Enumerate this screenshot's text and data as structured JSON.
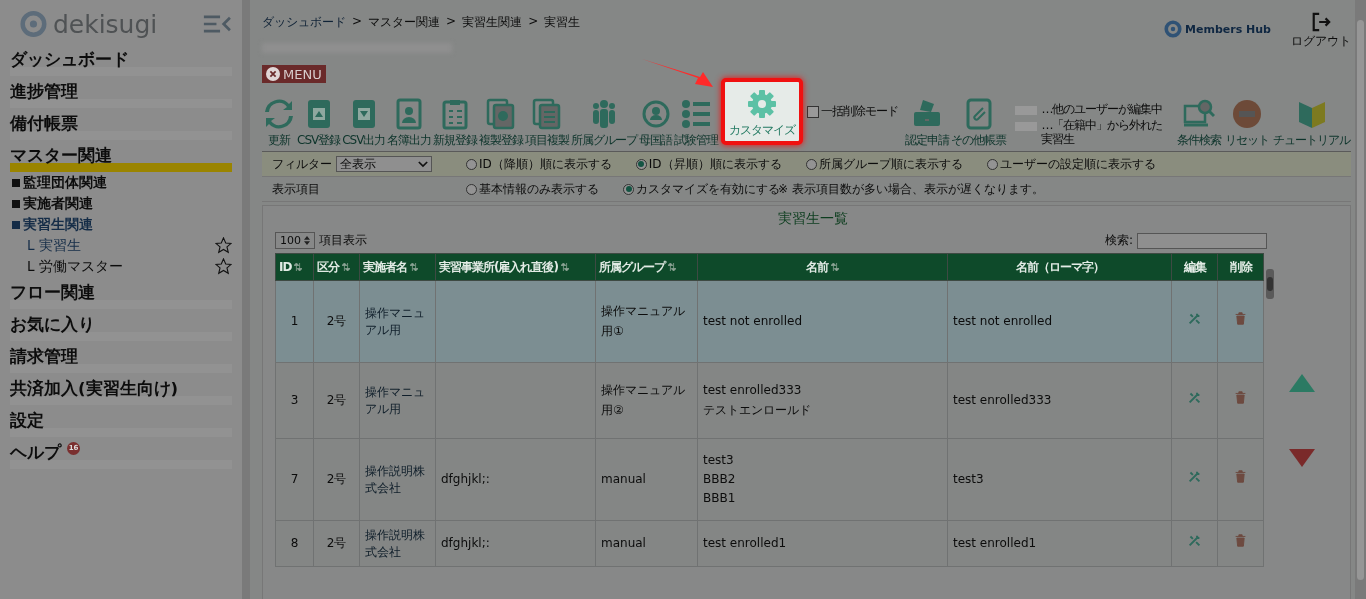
{
  "sidebar": {
    "logo": "dekisugi",
    "items": [
      {
        "label": "ダッシュボード",
        "selected": false
      },
      {
        "label": "進捗管理",
        "selected": false
      },
      {
        "label": "備付帳票",
        "selected": false
      },
      {
        "label": "マスター関連",
        "selected": true,
        "children": [
          {
            "label": "監理団体関連",
            "selected": false
          },
          {
            "label": "実施者関連",
            "selected": false
          },
          {
            "label": "実習生関連",
            "selected": true,
            "children": [
              {
                "label": "L 実習生",
                "selected": true,
                "starred": false
              },
              {
                "label": "L 労働マスター",
                "selected": false,
                "starred": false
              }
            ]
          }
        ]
      },
      {
        "label": "フロー関連",
        "selected": false
      },
      {
        "label": "お気に入り",
        "selected": false
      },
      {
        "label": "請求管理",
        "selected": false
      },
      {
        "label": "共済加入(実習生向け)",
        "selected": false
      },
      {
        "label": "設定",
        "selected": false
      },
      {
        "label": "ヘルプ",
        "selected": false,
        "badge": "16"
      }
    ]
  },
  "breadcrumb": [
    {
      "kind": "link",
      "text": "ダッシュボード"
    },
    {
      "kind": "sep",
      "text": ">"
    },
    {
      "kind": "text",
      "text": "マスター関連"
    },
    {
      "kind": "sep",
      "text": ">"
    },
    {
      "kind": "text",
      "text": "実習生関連"
    },
    {
      "kind": "sep",
      "text": ">"
    },
    {
      "kind": "text",
      "text": "実習生"
    }
  ],
  "header": {
    "brand": "Members Hub",
    "logout": "ログアウト"
  },
  "menu_button": "MENU",
  "tools": [
    {
      "label": "更新",
      "highlighted": false
    },
    {
      "label": "CSV登録",
      "highlighted": false
    },
    {
      "label": "CSV出力",
      "highlighted": false
    },
    {
      "label": "名簿出力",
      "highlighted": false
    },
    {
      "label": "新規登録",
      "highlighted": false
    },
    {
      "label": "複製登録",
      "highlighted": false
    },
    {
      "label": "項目複製",
      "highlighted": false
    },
    {
      "label": "所属グループ",
      "highlighted": false
    },
    {
      "label": "母国語",
      "highlighted": false
    },
    {
      "label": "試験管理",
      "highlighted": false
    },
    {
      "label": "カスタマイズ",
      "highlighted": true
    }
  ],
  "bulk_delete": {
    "label": "一括削除モード",
    "checked": false
  },
  "tools_2": [
    {
      "label": "認定申請"
    },
    {
      "label": "その他帳票"
    }
  ],
  "legend": [
    {
      "text": "…他のユーザーが編集中"
    },
    {
      "text": "…「在籍中」から外れた実習生"
    }
  ],
  "tools_3": [
    {
      "label": "条件検索"
    },
    {
      "label": "リセット"
    },
    {
      "label": "チュートリアル"
    }
  ],
  "filter": {
    "label": "フィルター",
    "value": "全表示",
    "options": [
      {
        "label": "ID（降順）順に表示する",
        "selected": false
      },
      {
        "label": "ID（昇順）順に表示する",
        "selected": true
      },
      {
        "label": "所属グループ順に表示する",
        "selected": false
      },
      {
        "label": "ユーザーの設定順に表示する",
        "selected": false
      }
    ]
  },
  "display": {
    "label": "表示項目",
    "options": [
      {
        "label": "基本情報のみ表示する",
        "selected": false
      },
      {
        "label": "カスタマイズを有効にする",
        "selected": true
      }
    ],
    "note": "※ 表示項目数が多い場合、表示が遅くなります。"
  },
  "panel": {
    "title": "実習生一覧",
    "page_size": "100",
    "page_size_label": "項目表示",
    "search_label": "検索:"
  },
  "table": {
    "columns": [
      {
        "label": "ID",
        "sortable": true
      },
      {
        "label": "区分",
        "sortable": true
      },
      {
        "label": "実施者名",
        "sortable": true
      },
      {
        "label": "実習事業所(雇入れ直後)",
        "sortable": true
      },
      {
        "label": "所属グループ",
        "sortable": true
      },
      {
        "label": "名前",
        "sortable": true
      },
      {
        "label": "名前（ローマ字）",
        "sortable": false
      },
      {
        "label": "編集",
        "sortable": false
      },
      {
        "label": "削除",
        "sortable": false
      }
    ],
    "rows": [
      {
        "id": "1",
        "category": "2号",
        "company": "操作マニュアル用",
        "office": "",
        "group": "操作マニュアル用①",
        "name": [
          "test not enrolled"
        ],
        "romaji": "test not enrolled",
        "highlighted": true
      },
      {
        "id": "3",
        "category": "2号",
        "company": "操作マニュアル用",
        "office": "",
        "group": "操作マニュアル用②",
        "name": [
          "test enrolled333",
          "テストエンロールド"
        ],
        "romaji": "test enrolled333",
        "highlighted": false
      },
      {
        "id": "7",
        "category": "2号",
        "company": "操作説明株式会社",
        "office": "dfghjkl;:",
        "group": "manual",
        "name": [
          "test3",
          "BBB2",
          "BBB1"
        ],
        "romaji": "test3",
        "highlighted": false
      },
      {
        "id": "8",
        "category": "2号",
        "company": "操作説明株式会社",
        "office": "dfghjkl;:",
        "group": "manual",
        "name": [
          "test enrolled1"
        ],
        "romaji": "test enrolled1",
        "highlighted": false
      }
    ]
  }
}
